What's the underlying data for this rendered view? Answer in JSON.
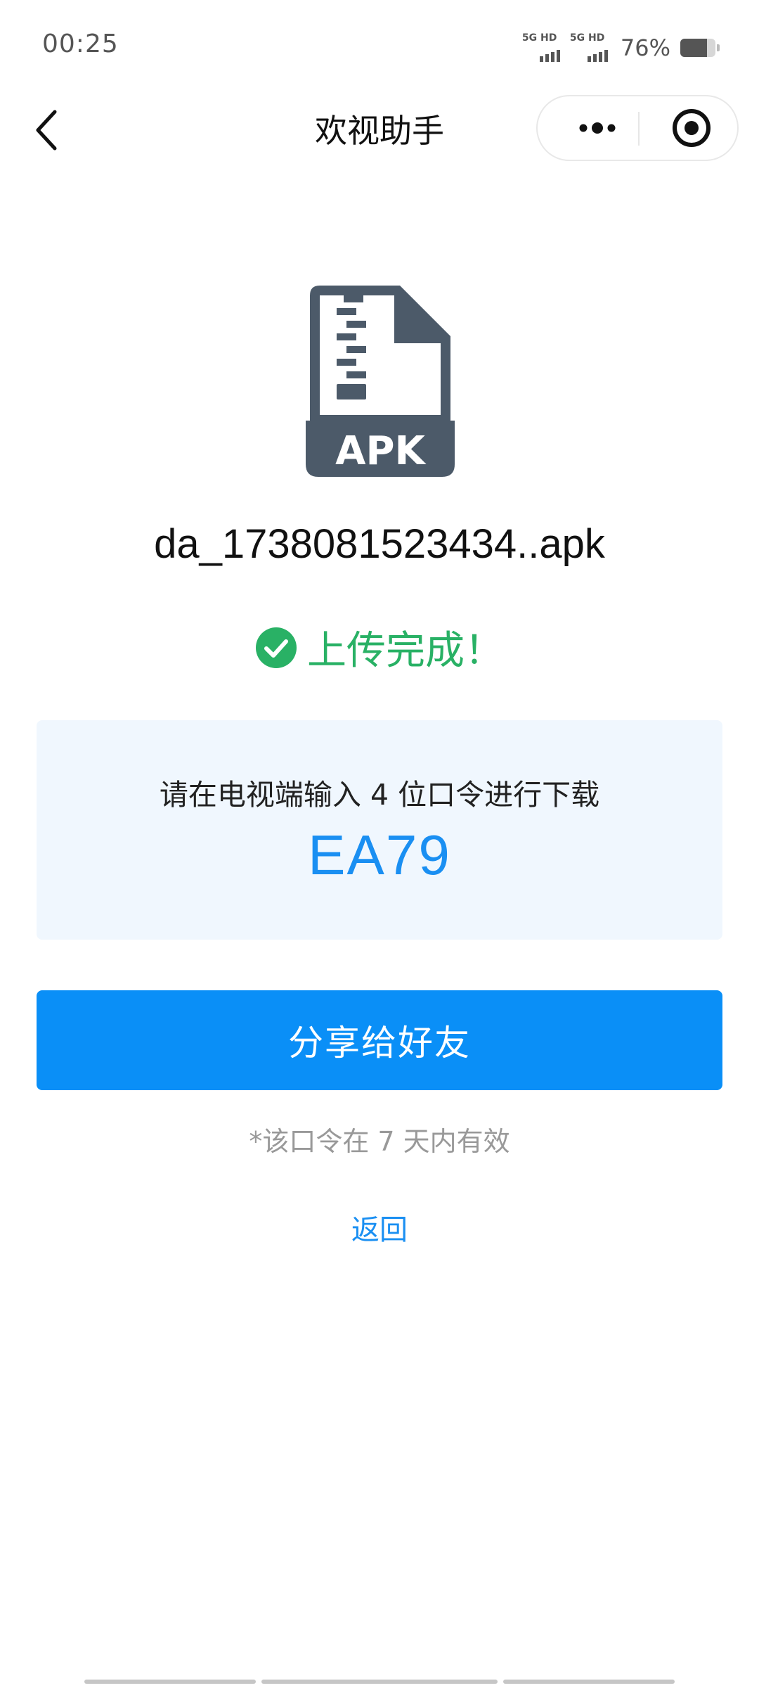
{
  "status_bar": {
    "time": "00:25",
    "sim1_label": "5G HD",
    "sim2_label": "5G HD",
    "battery_percent": "76%",
    "battery_level": 0.76
  },
  "nav": {
    "title": "欢视助手",
    "back_icon": "chevron-left-icon",
    "more_icon": "more-dots-icon",
    "close_icon": "target-circle-icon"
  },
  "file": {
    "icon": "apk-zip-file-icon",
    "icon_label": "APK",
    "name": "da_1738081523434..apk"
  },
  "upload_status": {
    "icon": "check-circle-icon",
    "text": "上传完成！",
    "color": "#29b165"
  },
  "code_card": {
    "hint": "请在电视端输入 4 位口令进行下载",
    "code": "EA79",
    "code_color": "#1a8ff2"
  },
  "actions": {
    "share_label": "分享给好友",
    "validity_note": "*该口令在 7 天内有效",
    "back_label": "返回"
  },
  "colors": {
    "primary": "#0a8ff7",
    "card_bg": "#f0f7fe",
    "icon_dark": "#4c5a69"
  }
}
